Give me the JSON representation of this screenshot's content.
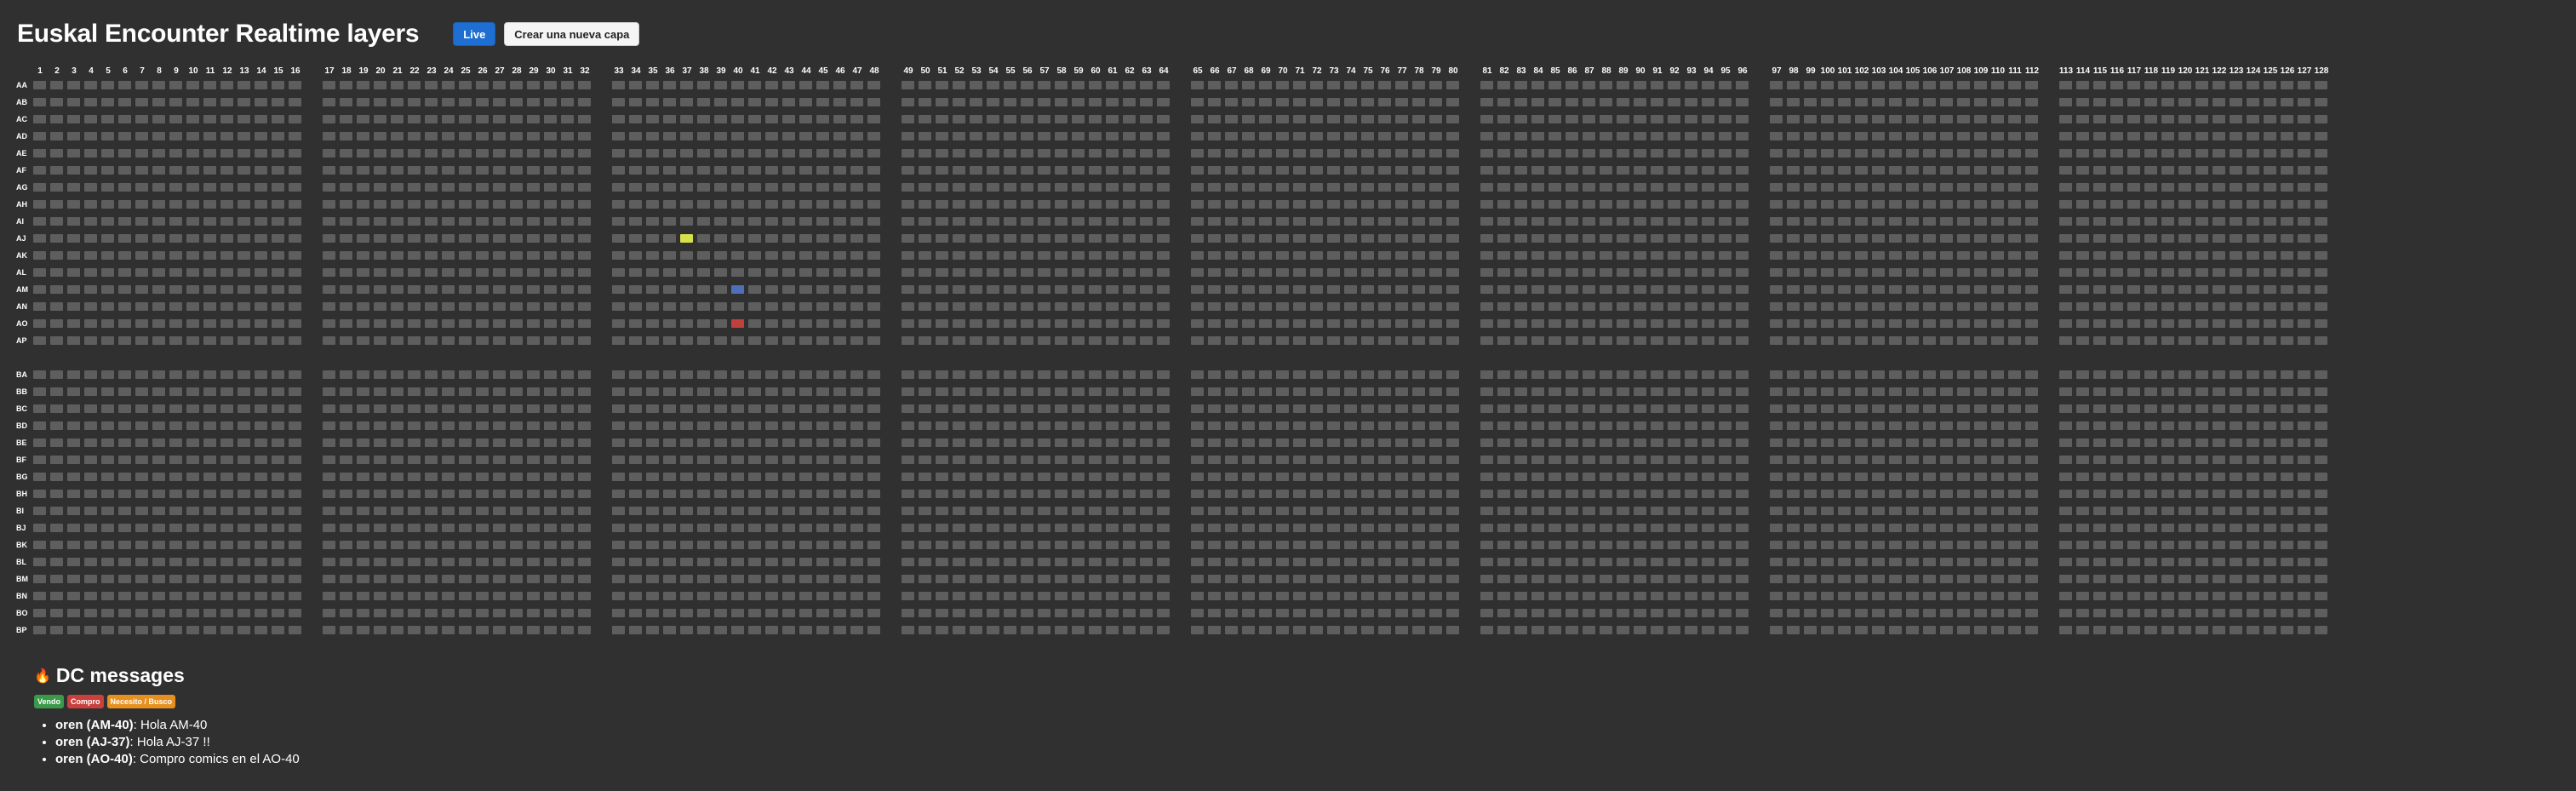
{
  "header": {
    "title": "Euskal Encounter Realtime layers",
    "live_label": "Live",
    "create_label": "Crear una nueva capa"
  },
  "grid": {
    "columns": 128,
    "block_size": 16,
    "column_labels": [
      "1",
      "2",
      "3",
      "4",
      "5",
      "6",
      "7",
      "8",
      "9",
      "10",
      "11",
      "12",
      "13",
      "14",
      "15",
      "16",
      "17",
      "18",
      "19",
      "20",
      "21",
      "22",
      "23",
      "24",
      "25",
      "26",
      "27",
      "28",
      "29",
      "30",
      "31",
      "32",
      "33",
      "34",
      "35",
      "36",
      "37",
      "38",
      "39",
      "40",
      "41",
      "42",
      "43",
      "44",
      "45",
      "46",
      "47",
      "48",
      "49",
      "50",
      "51",
      "52",
      "53",
      "54",
      "55",
      "56",
      "57",
      "58",
      "59",
      "60",
      "61",
      "62",
      "63",
      "64",
      "65",
      "66",
      "67",
      "68",
      "69",
      "70",
      "71",
      "72",
      "73",
      "74",
      "75",
      "76",
      "77",
      "78",
      "79",
      "80",
      "81",
      "82",
      "83",
      "84",
      "85",
      "86",
      "87",
      "88",
      "89",
      "90",
      "91",
      "92",
      "93",
      "94",
      "95",
      "96",
      "97",
      "98",
      "99",
      "100",
      "101",
      "102",
      "103",
      "104",
      "105",
      "106",
      "107",
      "108",
      "109",
      "110",
      "111",
      "112",
      "113",
      "114",
      "115",
      "116",
      "117",
      "118",
      "119",
      "120",
      "121",
      "122",
      "123",
      "124",
      "125",
      "126",
      "127",
      "128"
    ],
    "row_groups": [
      [
        "AA",
        "AB",
        "AC",
        "AD",
        "AE",
        "AF",
        "AG",
        "AH",
        "AI",
        "AJ",
        "AK",
        "AL",
        "AM",
        "AN",
        "AO",
        "AP"
      ],
      [
        "BA",
        "BB",
        "BC",
        "BD",
        "BE",
        "BF",
        "BG",
        "BH",
        "BI",
        "BJ",
        "BK",
        "BL",
        "BM",
        "BN",
        "BO",
        "BP"
      ]
    ],
    "seat_color": "#5e5e5e",
    "highlighted": [
      {
        "row": "AJ",
        "col": 37,
        "color": "#d6e04a"
      },
      {
        "row": "AM",
        "col": 40,
        "color": "#4f6fb8"
      },
      {
        "row": "AO",
        "col": 40,
        "color": "#c0403c"
      }
    ]
  },
  "dc": {
    "icon": "fire-icon",
    "title": "DC messages",
    "legend": [
      "Vendo",
      "Compro",
      "Necesito / Busco"
    ],
    "legend_colors": [
      "#3a9a4a",
      "#c9403d",
      "#e8901f"
    ],
    "messages": [
      {
        "user": "oren (AM-40)",
        "text": ": Hola AM-40"
      },
      {
        "user": "oren (AJ-37)",
        "text": ": Hola AJ-37 !!"
      },
      {
        "user": "oren (AO-40)",
        "text": ": Compro comics en el AO-40"
      }
    ]
  }
}
